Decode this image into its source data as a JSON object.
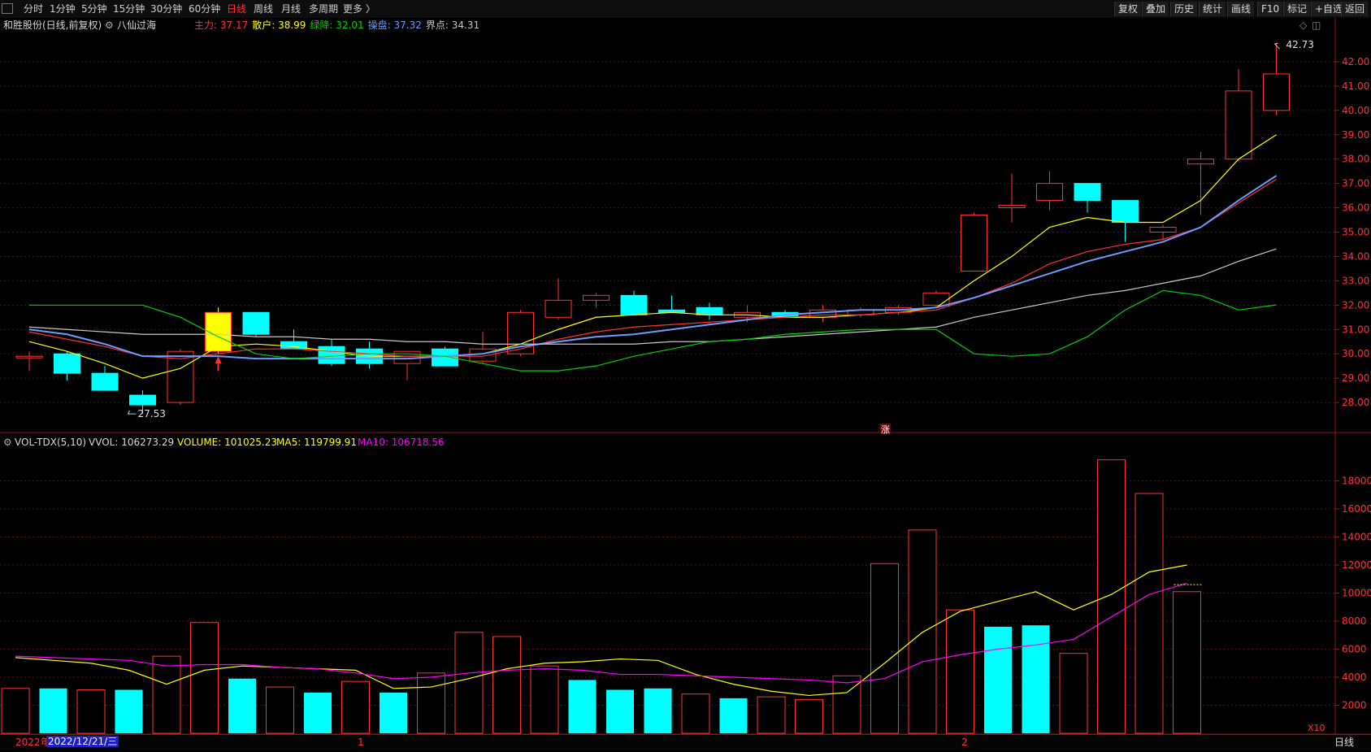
{
  "toolbar": {
    "period_tabs": [
      "分时",
      "1分钟",
      "5分钟",
      "15分钟",
      "30分钟",
      "60分钟",
      "日线",
      "周线",
      "月线",
      "多周期",
      "更多 〉"
    ],
    "active_tab": "日线",
    "right_buttons": [
      "复权",
      "叠加",
      "历史",
      "统计",
      "画线",
      "F10",
      "标记",
      "+自选",
      "返回"
    ]
  },
  "main_header": {
    "stock_title": "和胜股份(日线,前复权)",
    "indicator_name": "八仙过海",
    "values": [
      {
        "label": "主力: ",
        "value": "37.17",
        "color": "#ff3232"
      },
      {
        "label": "散户: ",
        "value": "38.99",
        "color": "#ffff00"
      },
      {
        "label": "绿降: ",
        "value": "32.01",
        "color": "#00d000"
      },
      {
        "label": "操盘: ",
        "value": "37.32",
        "color": "#6c9cff"
      },
      {
        "label": "界点: ",
        "value": "34.31",
        "color": "#c8c8c8"
      }
    ]
  },
  "volume_header": {
    "indicator": "VOL-TDX(5,10)",
    "vvol": "VVOL: 106273.29",
    "volume": "VOLUME: 101025.23",
    "ma5": "MA5: 119799.91",
    "ma10": "MA10: 106718.56"
  },
  "annotations": {
    "high": "42.73",
    "low": "27.53",
    "zhang_marker": "涨",
    "multiplier": "X10"
  },
  "bottom": {
    "year": "2022年",
    "date": "2022/12/21/三",
    "month1": "1",
    "month2": "2",
    "period_label": "日线"
  },
  "colors": {
    "up": "#ff3232",
    "down": "#00ffff",
    "ma_main": "#ff3232",
    "ma_retail": "#ffff00",
    "ma_green": "#00d000",
    "ma_blue": "#6c9cff",
    "ma_white": "#c8c8c8",
    "vol_ma10": "#ff00ff"
  },
  "chart_data": [
    {
      "type": "candlestick",
      "price_axis": {
        "min": 27.0,
        "max": 43.0,
        "ticks": [
          28.0,
          29.0,
          30.0,
          31.0,
          32.0,
          33.0,
          34.0,
          35.0,
          36.0,
          37.0,
          38.0,
          39.0,
          40.0,
          41.0,
          42.0
        ]
      },
      "candles": [
        {
          "o": 29.9,
          "h": 30.1,
          "l": 29.3,
          "c": 29.9
        },
        {
          "o": 30.0,
          "h": 30.1,
          "l": 28.9,
          "c": 29.2
        },
        {
          "o": 29.2,
          "h": 29.5,
          "l": 28.5,
          "c": 28.5
        },
        {
          "o": 28.3,
          "h": 28.5,
          "l": 27.53,
          "c": 27.9
        },
        {
          "o": 28.0,
          "h": 30.2,
          "l": 27.9,
          "c": 30.1
        },
        {
          "o": 30.1,
          "h": 31.9,
          "l": 30.0,
          "c": 31.7
        },
        {
          "o": 31.7,
          "h": 31.7,
          "l": 30.7,
          "c": 30.8
        },
        {
          "o": 30.5,
          "h": 31.0,
          "l": 30.2,
          "c": 30.2
        },
        {
          "o": 30.3,
          "h": 30.6,
          "l": 29.5,
          "c": 29.6
        },
        {
          "o": 30.2,
          "h": 30.5,
          "l": 29.4,
          "c": 29.6
        },
        {
          "o": 29.6,
          "h": 30.0,
          "l": 28.9,
          "c": 30.1
        },
        {
          "o": 30.2,
          "h": 30.3,
          "l": 29.5,
          "c": 29.5
        },
        {
          "o": 29.7,
          "h": 30.9,
          "l": 29.6,
          "c": 30.2
        },
        {
          "o": 30.0,
          "h": 31.8,
          "l": 29.9,
          "c": 31.7
        },
        {
          "o": 31.5,
          "h": 33.1,
          "l": 31.4,
          "c": 32.2
        },
        {
          "o": 32.2,
          "h": 32.5,
          "l": 31.9,
          "c": 32.4
        },
        {
          "o": 32.4,
          "h": 32.6,
          "l": 31.6,
          "c": 31.6
        },
        {
          "o": 31.8,
          "h": 32.4,
          "l": 31.7,
          "c": 31.7
        },
        {
          "o": 31.9,
          "h": 32.1,
          "l": 31.4,
          "c": 31.6
        },
        {
          "o": 31.5,
          "h": 32.0,
          "l": 31.3,
          "c": 31.7
        },
        {
          "o": 31.7,
          "h": 31.8,
          "l": 31.5,
          "c": 31.5
        },
        {
          "o": 31.5,
          "h": 32.0,
          "l": 31.3,
          "c": 31.8
        },
        {
          "o": 31.6,
          "h": 31.9,
          "l": 31.5,
          "c": 31.8
        },
        {
          "o": 31.7,
          "h": 32.0,
          "l": 31.6,
          "c": 31.9
        },
        {
          "o": 32.0,
          "h": 32.6,
          "l": 31.9,
          "c": 32.5
        },
        {
          "o": 33.4,
          "h": 35.8,
          "l": 33.4,
          "c": 35.7
        },
        {
          "o": 36.0,
          "h": 37.4,
          "l": 35.4,
          "c": 36.1
        },
        {
          "o": 36.3,
          "h": 37.5,
          "l": 35.9,
          "c": 37.0
        },
        {
          "o": 37.0,
          "h": 37.0,
          "l": 35.8,
          "c": 36.3
        },
        {
          "o": 36.3,
          "h": 36.3,
          "l": 34.6,
          "c": 35.4
        },
        {
          "o": 35.0,
          "h": 35.3,
          "l": 34.7,
          "c": 35.2
        },
        {
          "o": 37.8,
          "h": 38.3,
          "l": 35.7,
          "c": 38.0
        },
        {
          "o": 38.0,
          "h": 41.7,
          "l": 37.9,
          "c": 40.8
        },
        {
          "o": 40.0,
          "h": 42.73,
          "l": 39.8,
          "c": 41.5
        }
      ],
      "ma_lines": [
        {
          "color": "#ffff00",
          "values": [
            30.5,
            30.1,
            29.6,
            29.0,
            29.4,
            30.3,
            30.4,
            30.3,
            30.1,
            29.9,
            29.9,
            29.9,
            30.0,
            30.4,
            31.0,
            31.5,
            31.6,
            31.7,
            31.6,
            31.6,
            31.5,
            31.5,
            31.6,
            31.7,
            31.9,
            33.0,
            34.0,
            35.2,
            35.6,
            35.4,
            35.4,
            36.3,
            38.0,
            39.0
          ]
        },
        {
          "color": "#ff3232",
          "values": [
            30.9,
            30.6,
            30.3,
            29.9,
            29.8,
            30.0,
            30.2,
            30.2,
            30.1,
            30.0,
            29.9,
            29.9,
            29.9,
            30.2,
            30.6,
            30.9,
            31.1,
            31.2,
            31.3,
            31.4,
            31.5,
            31.6,
            31.6,
            31.7,
            31.8,
            32.3,
            32.9,
            33.7,
            34.2,
            34.5,
            34.7,
            35.2,
            36.2,
            37.17
          ]
        },
        {
          "color": "#6c9cff",
          "values": [
            31.0,
            30.8,
            30.4,
            29.9,
            29.9,
            29.9,
            29.8,
            29.8,
            29.8,
            29.8,
            29.8,
            29.9,
            30.0,
            30.3,
            30.5,
            30.7,
            30.8,
            31.0,
            31.2,
            31.4,
            31.6,
            31.7,
            31.8,
            31.8,
            31.9,
            32.3,
            32.8,
            33.3,
            33.8,
            34.2,
            34.6,
            35.2,
            36.3,
            37.32
          ]
        },
        {
          "color": "#c8c8c8",
          "values": [
            31.1,
            31.0,
            30.9,
            30.8,
            30.8,
            30.8,
            30.7,
            30.7,
            30.6,
            30.6,
            30.5,
            30.5,
            30.4,
            30.4,
            30.4,
            30.4,
            30.4,
            30.5,
            30.5,
            30.6,
            30.7,
            30.8,
            30.9,
            31.0,
            31.1,
            31.5,
            31.8,
            32.1,
            32.4,
            32.6,
            32.9,
            33.2,
            33.8,
            34.31
          ]
        },
        {
          "color": "#00d000",
          "values": [
            32.0,
            32.0,
            32.0,
            32.0,
            31.5,
            30.7,
            30.0,
            29.8,
            29.9,
            30.0,
            30.0,
            29.9,
            29.6,
            29.3,
            29.3,
            29.5,
            29.9,
            30.2,
            30.5,
            30.6,
            30.8,
            30.9,
            31.0,
            31.0,
            31.0,
            30.0,
            29.9,
            30.0,
            30.7,
            31.8,
            32.6,
            32.4,
            31.8,
            32.01
          ]
        }
      ]
    },
    {
      "type": "bar",
      "y_axis": {
        "min": 0,
        "max": 20000,
        "ticks": [
          2000,
          4000,
          6000,
          8000,
          10000,
          12000,
          14000,
          16000,
          18000
        ]
      },
      "values": [
        3200,
        3200,
        3100,
        3100,
        5500,
        7900,
        3900,
        3300,
        2900,
        3700,
        2900,
        4300,
        7200,
        6900,
        4800,
        3800,
        3100,
        3200,
        2800,
        2500,
        2600,
        2400,
        4100,
        12100,
        14500,
        8800,
        7600,
        7700,
        5700,
        19500,
        17100,
        10100
      ],
      "up": [
        true,
        false,
        true,
        false,
        true,
        true,
        false,
        true,
        false,
        true,
        false,
        true,
        true,
        true,
        true,
        false,
        false,
        false,
        true,
        false,
        true,
        true,
        true,
        true,
        true,
        true,
        false,
        false,
        true,
        true,
        true,
        true
      ],
      "ma5": [
        5400,
        5200,
        5000,
        4500,
        3500,
        4500,
        4800,
        4700,
        4600,
        4500,
        3200,
        3300,
        3900,
        4600,
        5000,
        5100,
        5300,
        5200,
        4200,
        3500,
        3000,
        2700,
        2900,
        5000,
        7200,
        8700,
        9400,
        10100,
        8800,
        9900,
        11500,
        12000
      ],
      "ma10": [
        5500,
        5400,
        5300,
        5200,
        4800,
        4900,
        4900,
        4700,
        4600,
        4300,
        3900,
        4000,
        4300,
        4500,
        4600,
        4500,
        4200,
        4200,
        4100,
        4000,
        3900,
        3800,
        3600,
        3900,
        5100,
        5600,
        6000,
        6300,
        6700,
        8300,
        9900,
        10700
      ]
    }
  ]
}
